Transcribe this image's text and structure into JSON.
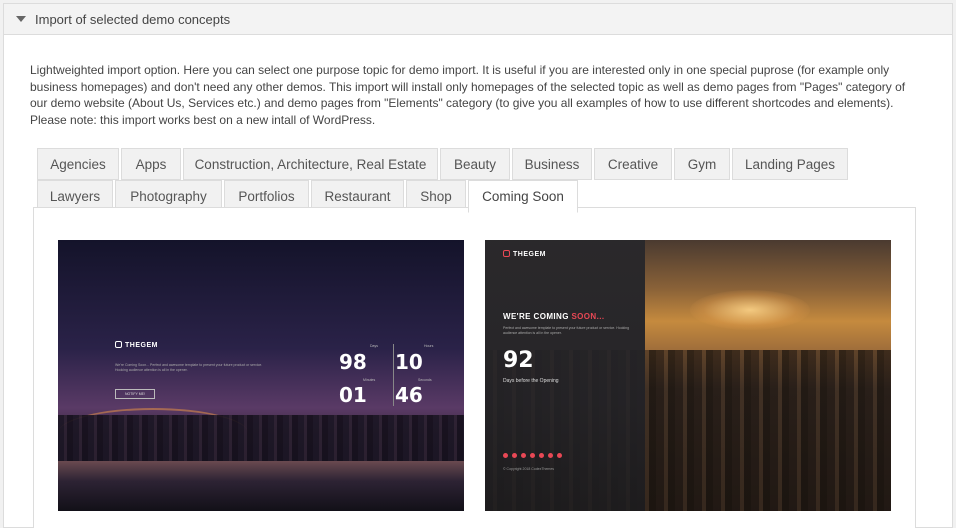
{
  "panel": {
    "title": "Import of selected demo concepts",
    "description": "Lightweighted import option. Here you can select one purpose topic for demo import. It is useful if you are interested only in one special puprose (for example only business homepages) and don't need any other demos. This import will install only homepages of the selected topic as well as demo pages from \"Pages\" category of our demo website (About Us, Services etc.) and demo pages from \"Elements\" category (to give you all examples of how to use different shortcodes and elements). Please note: this import works best on a new intall of WordPress."
  },
  "tabs": [
    {
      "label": "Agencies"
    },
    {
      "label": "Apps"
    },
    {
      "label": "Construction, Architecture, Real Estate"
    },
    {
      "label": "Beauty"
    },
    {
      "label": "Business"
    },
    {
      "label": "Creative"
    },
    {
      "label": "Gym"
    },
    {
      "label": "Landing Pages"
    },
    {
      "label": "Lawyers"
    },
    {
      "label": "Photography"
    },
    {
      "label": "Portfolios"
    },
    {
      "label": "Restaurant"
    },
    {
      "label": "Shop"
    },
    {
      "label": "Coming Soon",
      "active": true
    }
  ],
  "demos": {
    "first": {
      "logo": "THEGEM",
      "copy": "We're Coming Soon... Perfect and awesome template to present your future product or service. Hooking audience attention is all in the opener.",
      "button": "NOTIFY ME!",
      "counters": {
        "days": "98",
        "days_label": "Days",
        "hours": "10",
        "hours_label": "Hours",
        "minutes": "01",
        "minutes_label": "Minutes",
        "seconds": "46",
        "seconds_label": "Seconds"
      }
    },
    "second": {
      "logo": "THEGEM",
      "heading_main": "WE'RE COMING ",
      "heading_accent": "SOON...",
      "copy": "Perfect and awesome template to present your future product or service. Hooking audience attention is all in the opener.",
      "days_value": "92",
      "days_label": "Days before the Opening",
      "footer": "© Copyright 2018 CodexThemes"
    }
  },
  "colors": {
    "accent": "#e84855",
    "border": "#dcdcdc",
    "tab_bg": "#f1f1f1"
  }
}
